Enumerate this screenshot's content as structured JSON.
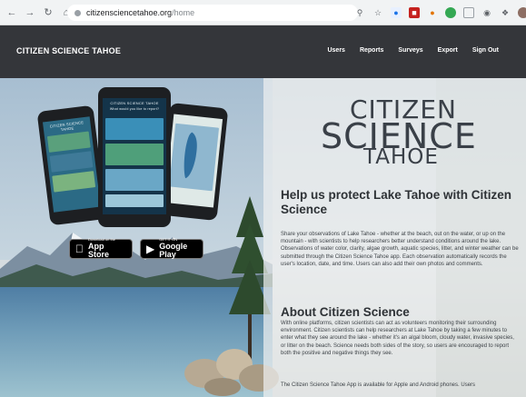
{
  "browser": {
    "url_host": "citizensciencetahoe.org",
    "url_path": "/home",
    "icons": [
      "back-arrow-icon",
      "forward-arrow-icon",
      "reload-icon",
      "search-icon",
      "star-icon",
      "extension-icon",
      "pdf-icon",
      "extension-icon",
      "extension-icon",
      "extension-icon",
      "extension-icon",
      "puzzle-icon",
      "profile-avatar-icon"
    ]
  },
  "site": {
    "brand": "CITIZEN SCIENCE TAHOE",
    "nav": [
      "Users",
      "Reports",
      "Surveys",
      "Export",
      "Sign Out"
    ]
  },
  "hero": {
    "logo": [
      "CITIZEN",
      "SCIENCE",
      "TAHOE"
    ],
    "headline": "Help us protect Lake Tahoe with Citizen Science",
    "intro": "Share your observations of Lake Tahoe - whether at the beach, out on the water, or up on the mountain - with scientists to help researchers better understand conditions around the lake. Observations of water color, clarity, algae growth, aquatic species, litter, and winter weather can be submitted through the Citizen Science Tahoe app. Each observation automatically records the user's location, date, and time. Users can also add their own photos and comments.",
    "about_title": "About Citizen Science",
    "about_text": "With online platforms, citizen scientists can act as volunteers monitoring their surrounding environment. Citizen scientists can help researchers at Lake Tahoe by taking a few minutes to enter what they see around the lake - whether it's an algal bloom, cloudy water, invasive species, or litter on the beach. Science needs both sides of the story, so users are encouraged to report both the positive and negative things they see.",
    "availability": "The Citizen Science Tahoe App is available for Apple and Android phones. Users"
  },
  "badges": {
    "app_store_small": "Download on the",
    "app_store_big": "App Store",
    "google_small": "GET IT ON",
    "google_big": "Google Play"
  },
  "phones": {
    "center_title": "CITIZEN SCIENCE TAHOE",
    "center_prompt": "What would you like to report?",
    "left_title": "CITIZEN SCIENCE TAHOE"
  },
  "colors": {
    "header_bg": "#34363a",
    "text_dark": "#2e3236",
    "lake": "#4f7ea4"
  }
}
